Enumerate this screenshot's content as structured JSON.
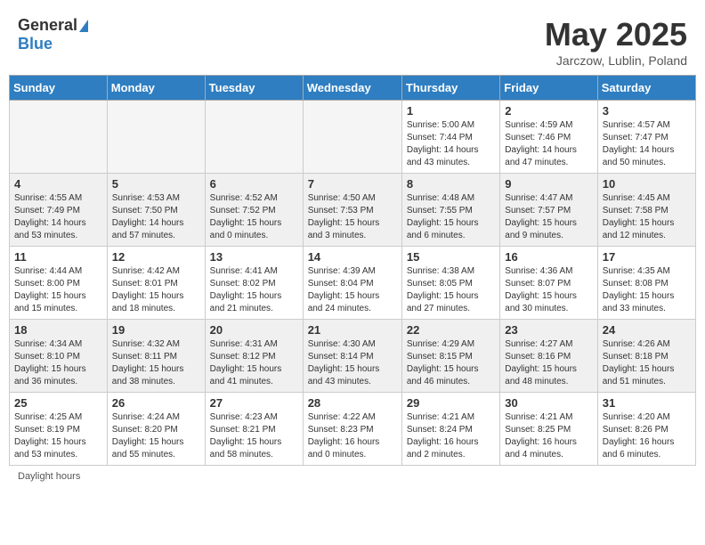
{
  "header": {
    "logo_general": "General",
    "logo_blue": "Blue",
    "month_title": "May 2025",
    "location": "Jarczow, Lublin, Poland"
  },
  "days_of_week": [
    "Sunday",
    "Monday",
    "Tuesday",
    "Wednesday",
    "Thursday",
    "Friday",
    "Saturday"
  ],
  "weeks": [
    [
      {
        "day": "",
        "info": ""
      },
      {
        "day": "",
        "info": ""
      },
      {
        "day": "",
        "info": ""
      },
      {
        "day": "",
        "info": ""
      },
      {
        "day": "1",
        "info": "Sunrise: 5:00 AM\nSunset: 7:44 PM\nDaylight: 14 hours\nand 43 minutes."
      },
      {
        "day": "2",
        "info": "Sunrise: 4:59 AM\nSunset: 7:46 PM\nDaylight: 14 hours\nand 47 minutes."
      },
      {
        "day": "3",
        "info": "Sunrise: 4:57 AM\nSunset: 7:47 PM\nDaylight: 14 hours\nand 50 minutes."
      }
    ],
    [
      {
        "day": "4",
        "info": "Sunrise: 4:55 AM\nSunset: 7:49 PM\nDaylight: 14 hours\nand 53 minutes."
      },
      {
        "day": "5",
        "info": "Sunrise: 4:53 AM\nSunset: 7:50 PM\nDaylight: 14 hours\nand 57 minutes."
      },
      {
        "day": "6",
        "info": "Sunrise: 4:52 AM\nSunset: 7:52 PM\nDaylight: 15 hours\nand 0 minutes."
      },
      {
        "day": "7",
        "info": "Sunrise: 4:50 AM\nSunset: 7:53 PM\nDaylight: 15 hours\nand 3 minutes."
      },
      {
        "day": "8",
        "info": "Sunrise: 4:48 AM\nSunset: 7:55 PM\nDaylight: 15 hours\nand 6 minutes."
      },
      {
        "day": "9",
        "info": "Sunrise: 4:47 AM\nSunset: 7:57 PM\nDaylight: 15 hours\nand 9 minutes."
      },
      {
        "day": "10",
        "info": "Sunrise: 4:45 AM\nSunset: 7:58 PM\nDaylight: 15 hours\nand 12 minutes."
      }
    ],
    [
      {
        "day": "11",
        "info": "Sunrise: 4:44 AM\nSunset: 8:00 PM\nDaylight: 15 hours\nand 15 minutes."
      },
      {
        "day": "12",
        "info": "Sunrise: 4:42 AM\nSunset: 8:01 PM\nDaylight: 15 hours\nand 18 minutes."
      },
      {
        "day": "13",
        "info": "Sunrise: 4:41 AM\nSunset: 8:02 PM\nDaylight: 15 hours\nand 21 minutes."
      },
      {
        "day": "14",
        "info": "Sunrise: 4:39 AM\nSunset: 8:04 PM\nDaylight: 15 hours\nand 24 minutes."
      },
      {
        "day": "15",
        "info": "Sunrise: 4:38 AM\nSunset: 8:05 PM\nDaylight: 15 hours\nand 27 minutes."
      },
      {
        "day": "16",
        "info": "Sunrise: 4:36 AM\nSunset: 8:07 PM\nDaylight: 15 hours\nand 30 minutes."
      },
      {
        "day": "17",
        "info": "Sunrise: 4:35 AM\nSunset: 8:08 PM\nDaylight: 15 hours\nand 33 minutes."
      }
    ],
    [
      {
        "day": "18",
        "info": "Sunrise: 4:34 AM\nSunset: 8:10 PM\nDaylight: 15 hours\nand 36 minutes."
      },
      {
        "day": "19",
        "info": "Sunrise: 4:32 AM\nSunset: 8:11 PM\nDaylight: 15 hours\nand 38 minutes."
      },
      {
        "day": "20",
        "info": "Sunrise: 4:31 AM\nSunset: 8:12 PM\nDaylight: 15 hours\nand 41 minutes."
      },
      {
        "day": "21",
        "info": "Sunrise: 4:30 AM\nSunset: 8:14 PM\nDaylight: 15 hours\nand 43 minutes."
      },
      {
        "day": "22",
        "info": "Sunrise: 4:29 AM\nSunset: 8:15 PM\nDaylight: 15 hours\nand 46 minutes."
      },
      {
        "day": "23",
        "info": "Sunrise: 4:27 AM\nSunset: 8:16 PM\nDaylight: 15 hours\nand 48 minutes."
      },
      {
        "day": "24",
        "info": "Sunrise: 4:26 AM\nSunset: 8:18 PM\nDaylight: 15 hours\nand 51 minutes."
      }
    ],
    [
      {
        "day": "25",
        "info": "Sunrise: 4:25 AM\nSunset: 8:19 PM\nDaylight: 15 hours\nand 53 minutes."
      },
      {
        "day": "26",
        "info": "Sunrise: 4:24 AM\nSunset: 8:20 PM\nDaylight: 15 hours\nand 55 minutes."
      },
      {
        "day": "27",
        "info": "Sunrise: 4:23 AM\nSunset: 8:21 PM\nDaylight: 15 hours\nand 58 minutes."
      },
      {
        "day": "28",
        "info": "Sunrise: 4:22 AM\nSunset: 8:23 PM\nDaylight: 16 hours\nand 0 minutes."
      },
      {
        "day": "29",
        "info": "Sunrise: 4:21 AM\nSunset: 8:24 PM\nDaylight: 16 hours\nand 2 minutes."
      },
      {
        "day": "30",
        "info": "Sunrise: 4:21 AM\nSunset: 8:25 PM\nDaylight: 16 hours\nand 4 minutes."
      },
      {
        "day": "31",
        "info": "Sunrise: 4:20 AM\nSunset: 8:26 PM\nDaylight: 16 hours\nand 6 minutes."
      }
    ]
  ],
  "footer": {
    "daylight_hours": "Daylight hours"
  }
}
